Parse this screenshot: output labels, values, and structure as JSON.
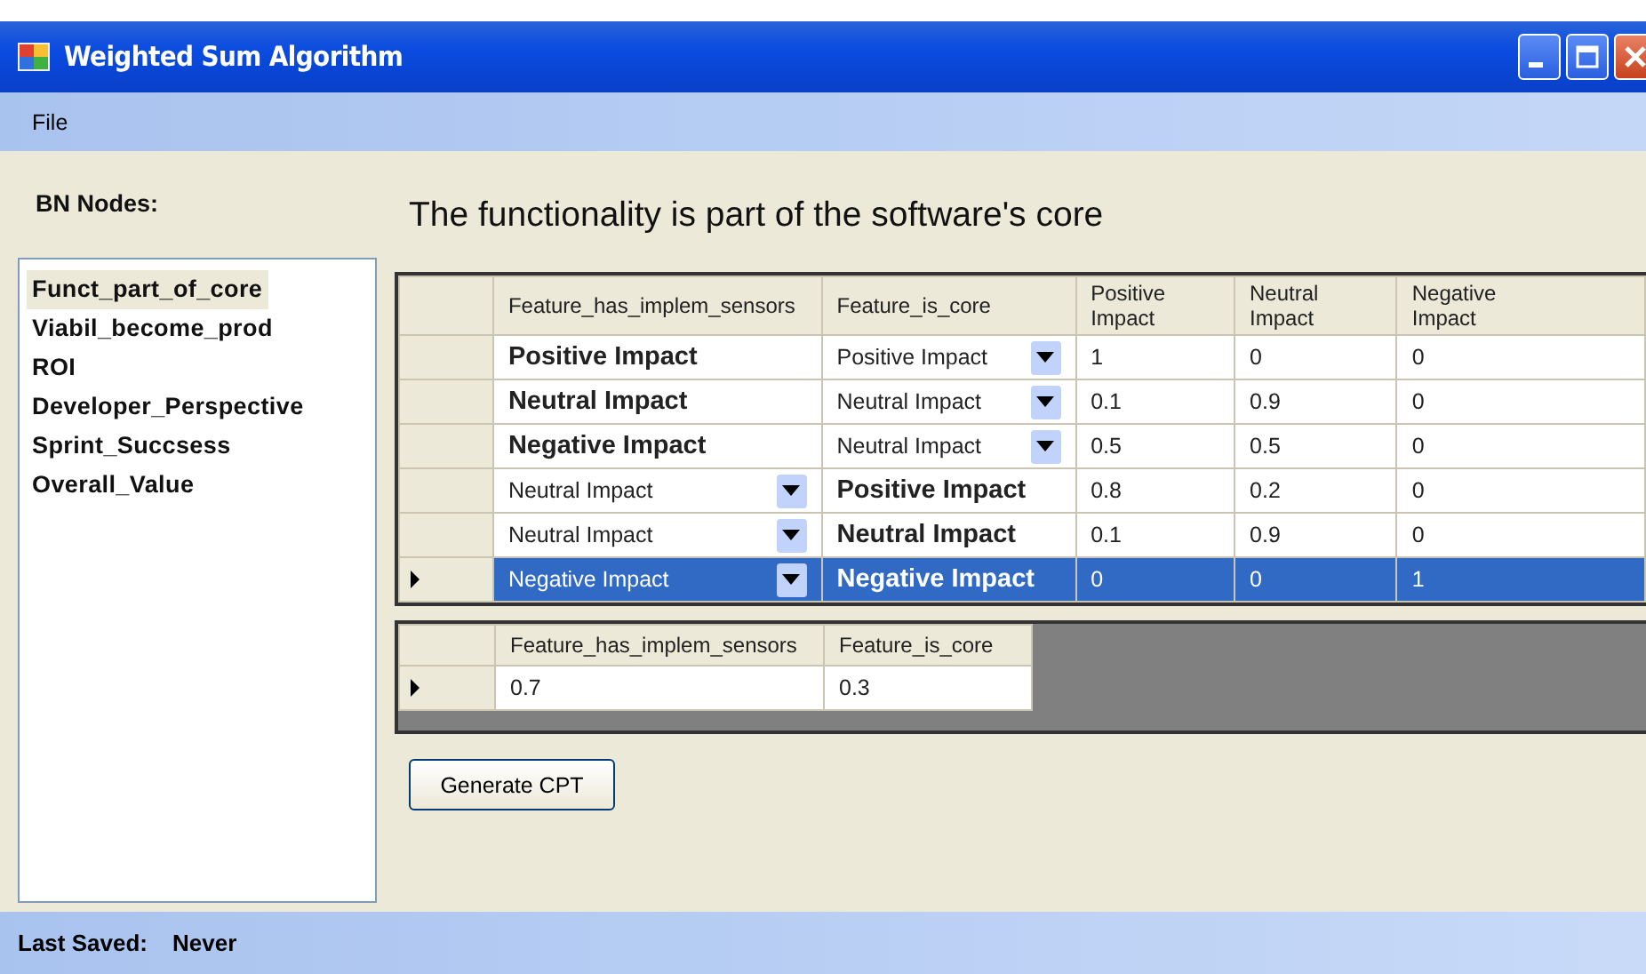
{
  "window": {
    "title": "Weighted Sum Algorithm"
  },
  "menu": [
    "File"
  ],
  "nodes_label": "BN Nodes:",
  "nodes": [
    {
      "label": "Funct_part_of_core",
      "selected": true
    },
    {
      "label": "Viabil_become_prod",
      "selected": false
    },
    {
      "label": "ROI",
      "selected": false
    },
    {
      "label": "Developer_Perspective",
      "selected": false
    },
    {
      "label": "Sprint_Succsess",
      "selected": false
    },
    {
      "label": "Overall_Value",
      "selected": false
    }
  ],
  "heading": "The functionality is part of the software's core",
  "cpt_table": {
    "columns": [
      "Feature_has_implem_sensors",
      "Feature_is_core",
      "Positive Impact",
      "Neutral Impact",
      "Negative Impact"
    ],
    "rows": [
      {
        "selected": false,
        "cells": [
          {
            "kind": "fixed",
            "text": "Positive Impact"
          },
          {
            "kind": "dropdown",
            "text": "Positive Impact"
          },
          {
            "kind": "value",
            "text": "1"
          },
          {
            "kind": "value",
            "text": "0"
          },
          {
            "kind": "value",
            "text": "0"
          }
        ]
      },
      {
        "selected": false,
        "cells": [
          {
            "kind": "fixed",
            "text": "Neutral Impact"
          },
          {
            "kind": "dropdown",
            "text": "Neutral Impact"
          },
          {
            "kind": "value",
            "text": "0.1"
          },
          {
            "kind": "value",
            "text": "0.9"
          },
          {
            "kind": "value",
            "text": "0"
          }
        ]
      },
      {
        "selected": false,
        "cells": [
          {
            "kind": "fixed",
            "text": "Negative Impact"
          },
          {
            "kind": "dropdown",
            "text": "Neutral Impact"
          },
          {
            "kind": "value",
            "text": "0.5"
          },
          {
            "kind": "value",
            "text": "0.5"
          },
          {
            "kind": "value",
            "text": "0"
          }
        ]
      },
      {
        "selected": false,
        "cells": [
          {
            "kind": "dropdown",
            "text": "Neutral Impact"
          },
          {
            "kind": "fixed",
            "text": "Positive Impact"
          },
          {
            "kind": "value",
            "text": "0.8"
          },
          {
            "kind": "value",
            "text": "0.2"
          },
          {
            "kind": "value",
            "text": "0"
          }
        ]
      },
      {
        "selected": false,
        "cells": [
          {
            "kind": "dropdown",
            "text": "Neutral Impact"
          },
          {
            "kind": "fixed",
            "text": "Neutral Impact"
          },
          {
            "kind": "value",
            "text": "0.1"
          },
          {
            "kind": "value",
            "text": "0.9"
          },
          {
            "kind": "value",
            "text": "0"
          }
        ]
      },
      {
        "selected": true,
        "cells": [
          {
            "kind": "dropdown",
            "text": "Negative Impact"
          },
          {
            "kind": "fixed",
            "text": "Negative Impact"
          },
          {
            "kind": "value",
            "text": "0"
          },
          {
            "kind": "value",
            "text": "0"
          },
          {
            "kind": "value",
            "text": "1"
          }
        ]
      }
    ]
  },
  "weights_table": {
    "columns": [
      "Feature_has_implem_sensors",
      "Feature_is_core"
    ],
    "rows": [
      {
        "selected": true,
        "cells": [
          {
            "kind": "input",
            "text": "0.7"
          },
          {
            "kind": "input",
            "text": "0.3"
          }
        ]
      }
    ]
  },
  "generate_button": "Generate CPT",
  "status_bar": {
    "label": "Last Saved:",
    "value": "Never"
  }
}
